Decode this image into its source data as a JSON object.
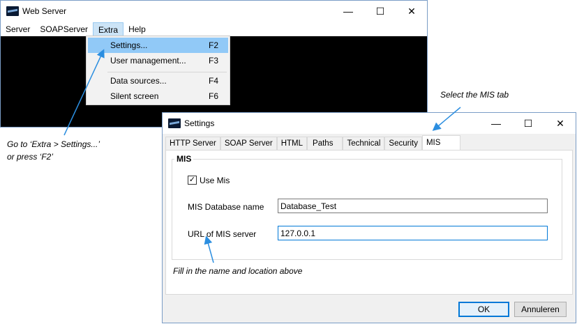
{
  "main_window": {
    "title": "Web Server",
    "controls": {
      "minimize": "—",
      "maximize": "☐",
      "close": "✕"
    },
    "menu": [
      "Server",
      "SOAPServer",
      "Extra",
      "Help"
    ],
    "active_menu": "Extra"
  },
  "dropdown": {
    "items": [
      {
        "label": "Settings...",
        "shortcut": "F2",
        "highlighted": true
      },
      {
        "label": "User management...",
        "shortcut": "F3"
      },
      {
        "label": "Data sources...",
        "shortcut": "F4"
      },
      {
        "label": "Silent screen",
        "shortcut": "F6"
      }
    ]
  },
  "settings_window": {
    "title": "Settings",
    "controls": {
      "minimize": "—",
      "maximize": "☐",
      "close": "✕"
    },
    "tabs": [
      "HTTP Server",
      "SOAP Server",
      "HTML",
      "Paths",
      "Technical",
      "Security",
      "MIS"
    ],
    "selected_tab": "MIS",
    "group_title": "MIS",
    "use_mis_label": "Use Mis",
    "use_mis_checked": true,
    "check_mark": "✓",
    "db_name_label": "MIS Database name",
    "db_name_value": "Database_Test",
    "url_label": "URL of MIS server",
    "url_value": "127.0.0.1",
    "ok_label": "OK",
    "cancel_label": "Annuleren"
  },
  "annotations": {
    "goto_line1": "Go to ‘Extra > Settings...’",
    "goto_line2": "or press ‘F2’",
    "select_tab": "Select the MIS tab",
    "fill_in": "Fill in the name and location above"
  },
  "colors": {
    "arrow": "#2b8ee0",
    "highlight": "#91c9f7",
    "accent": "#0078d7"
  }
}
